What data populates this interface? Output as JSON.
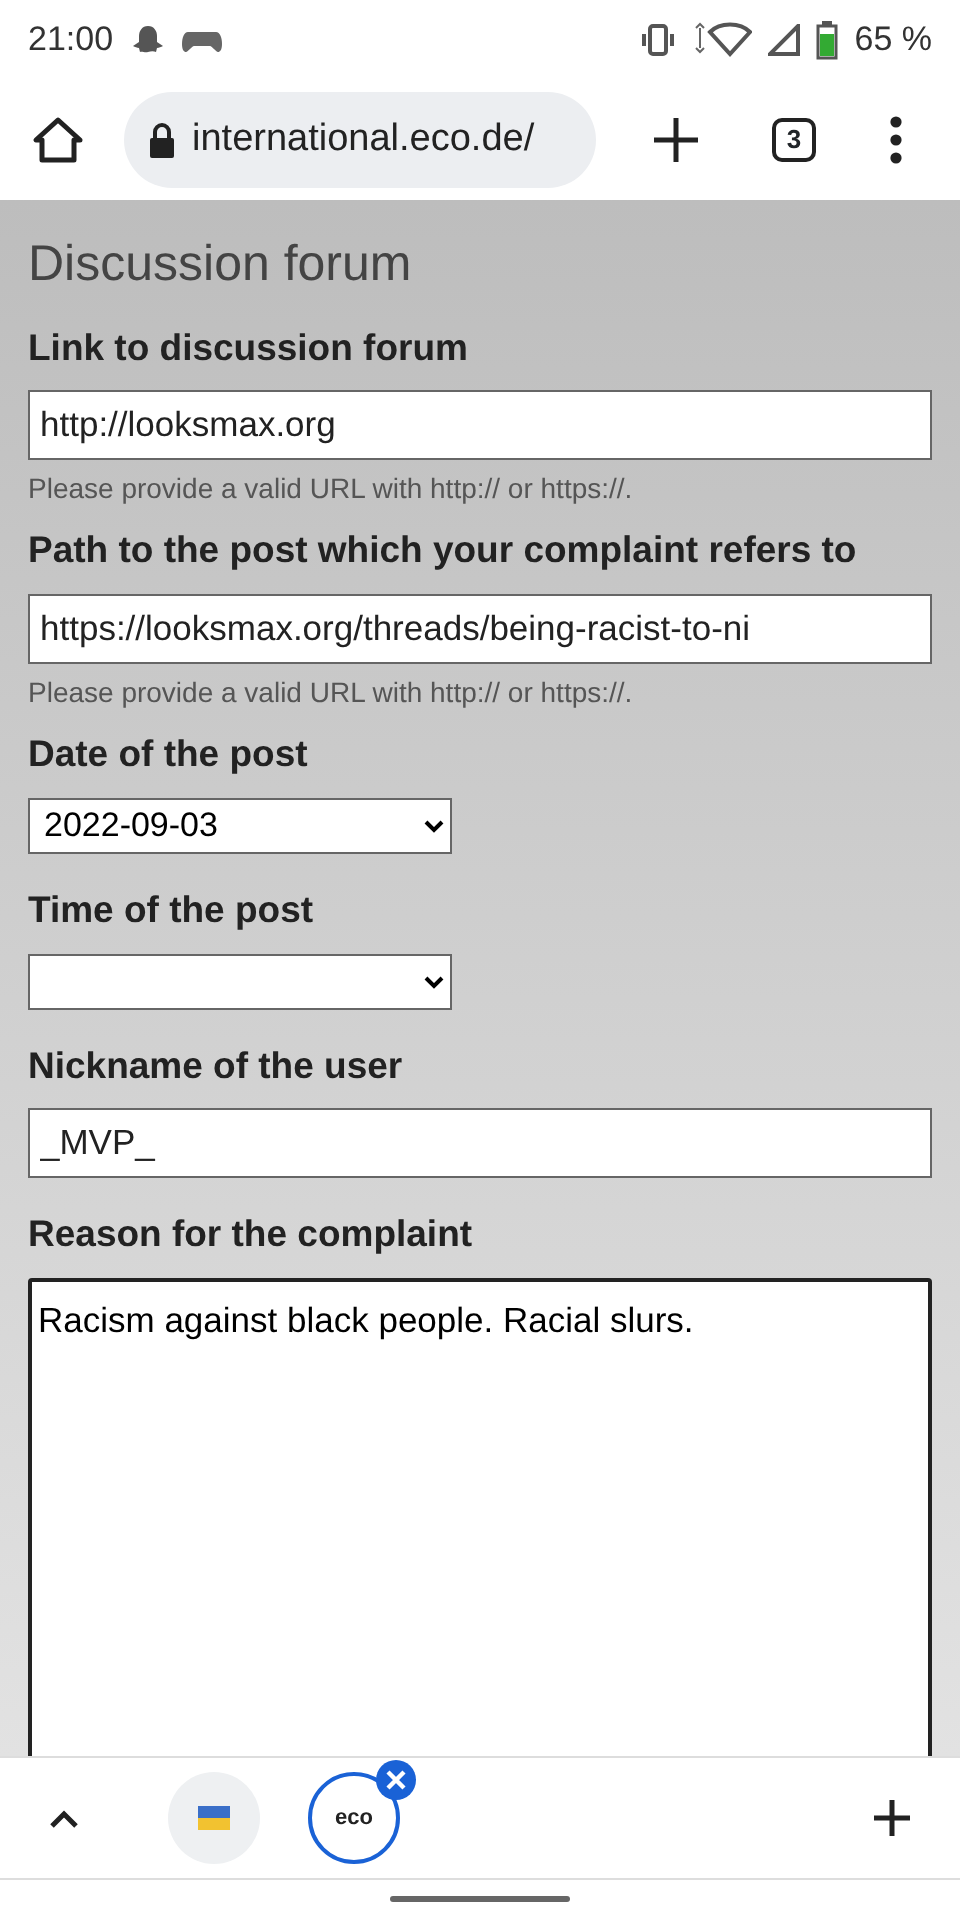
{
  "status_bar": {
    "time": "21:00",
    "battery": "65 %"
  },
  "browser": {
    "address": "international.eco.de/",
    "tab_count": "3"
  },
  "page": {
    "title": "Discussion forum",
    "fields": [
      {
        "kind": "text",
        "label": "Link to discussion forum",
        "value": "http://looksmax.org",
        "hint": "Please provide a valid URL with http:// or https://."
      },
      {
        "kind": "text",
        "label": "Path to the post which your complaint refers to",
        "value": "https://looksmax.org/threads/being-racist-to-ni",
        "hint": "Please provide a valid URL with http:// or https://."
      },
      {
        "kind": "select",
        "label": "Date of the post",
        "value": "2022-09-03"
      },
      {
        "kind": "select",
        "label": "Time of the post"
      },
      {
        "kind": "text",
        "label": "Nickname of the user",
        "value": "_MVP_"
      },
      {
        "kind": "textarea",
        "label": "Reason for the complaint",
        "value": "Racism against black people. Racial slurs."
      }
    ]
  },
  "tab_strip": {
    "tabs": [
      {
        "selected": false
      },
      {
        "logo": "eco",
        "selected": true
      }
    ]
  }
}
